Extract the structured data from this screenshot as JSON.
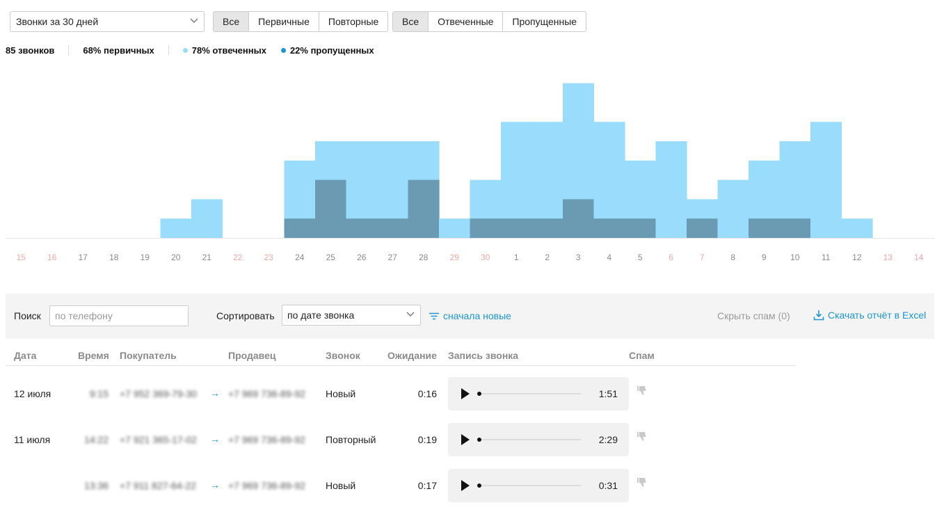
{
  "filters": {
    "period": "Звонки за 30 дней",
    "type_buttons": [
      {
        "label": "Все",
        "active": true
      },
      {
        "label": "Первичные",
        "active": false
      },
      {
        "label": "Повторные",
        "active": false
      }
    ],
    "status_buttons": [
      {
        "label": "Все",
        "active": true
      },
      {
        "label": "Отвеченные",
        "active": false
      },
      {
        "label": "Пропущенные",
        "active": false
      }
    ]
  },
  "stats": {
    "total": "85 звонков",
    "primary": "68% первичных",
    "answered": "78% отвеченных",
    "missed": "22% пропущенных"
  },
  "colors": {
    "answered": "#99dcfc",
    "missed": "#6a9bb3",
    "accent": "#1b95d3",
    "weekend": "#f4a7a7",
    "weekday": "#8a8a8a"
  },
  "chart_data": {
    "type": "bar",
    "stacked": true,
    "categories": [
      "15",
      "16",
      "17",
      "18",
      "19",
      "20",
      "21",
      "22",
      "23",
      "24",
      "25",
      "26",
      "27",
      "28",
      "29",
      "30",
      "1",
      "2",
      "3",
      "4",
      "5",
      "6",
      "7",
      "8",
      "9",
      "10",
      "11",
      "12",
      "13",
      "14"
    ],
    "weekend": [
      true,
      true,
      false,
      false,
      false,
      false,
      false,
      true,
      true,
      false,
      false,
      false,
      false,
      false,
      true,
      true,
      false,
      false,
      false,
      false,
      false,
      true,
      true,
      false,
      false,
      false,
      false,
      false,
      true,
      true
    ],
    "series": [
      {
        "key": "answered",
        "values": [
          0,
          0,
          0,
          0,
          0,
          1,
          2,
          0,
          0,
          3,
          2,
          4,
          4,
          2,
          1,
          2,
          5,
          5,
          6,
          5,
          3,
          5,
          1,
          3,
          3,
          4,
          6,
          1,
          0,
          0
        ]
      },
      {
        "key": "missed",
        "values": [
          0,
          0,
          0,
          0,
          0,
          0,
          0,
          0,
          0,
          1,
          3,
          1,
          1,
          3,
          0,
          1,
          1,
          1,
          2,
          1,
          1,
          0,
          1,
          0,
          1,
          1,
          0,
          0,
          0,
          0
        ]
      }
    ],
    "ylim": [
      0,
      9
    ]
  },
  "toolbar": {
    "search_label": "Поиск",
    "search_placeholder": "по телефону",
    "sort_label": "Сортировать",
    "sort_value": "по дате звонка",
    "order_label": "сначала новые",
    "spam_toggle": "Скрыть спам (0)",
    "excel_label": "Скачать отчёт в Excel"
  },
  "table": {
    "headers": {
      "date": "Дата",
      "time": "Время",
      "buyer": "Покупатель",
      "seller": "Продавец",
      "call": "Звонок",
      "wait": "Ожидание",
      "record": "Запись звонка",
      "spam": "Спам"
    },
    "rows": [
      {
        "date": "12 июля",
        "time": "9:15",
        "buyer": "+7 952 369-79-30",
        "seller": "+7 969 736-89-92",
        "call": "Новый",
        "wait": "0:16",
        "duration": "1:51"
      },
      {
        "date": "11 июля",
        "time": "14:22",
        "buyer": "+7 921 365-17-02",
        "seller": "+7 969 736-89-92",
        "call": "Повторный",
        "wait": "0:19",
        "duration": "2:29"
      },
      {
        "date": "",
        "time": "13:36",
        "buyer": "+7 911 827-64-22",
        "seller": "+7 969 736-89-92",
        "call": "Новый",
        "wait": "0:17",
        "duration": "0:31"
      }
    ]
  }
}
